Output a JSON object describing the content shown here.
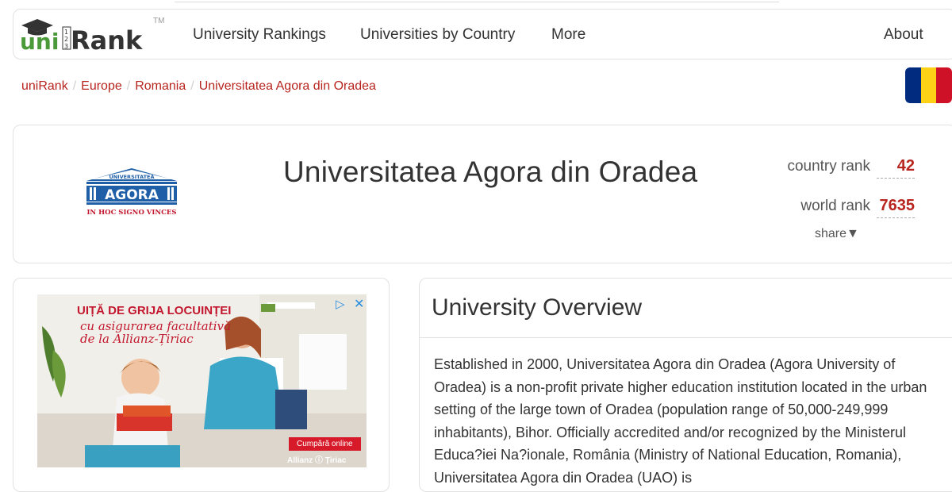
{
  "nav": {
    "logo_text": "uniRank",
    "logo_tm": "TM",
    "links": [
      "University Rankings",
      "Universities by Country",
      "More"
    ],
    "about": "About"
  },
  "breadcrumb": [
    "uniRank",
    "Europe",
    "Romania",
    "Universitatea Agora din Oradea"
  ],
  "flag_colors": [
    "#002b7f",
    "#fcd116",
    "#ce1126"
  ],
  "university": {
    "name": "Universitatea Agora din Oradea",
    "logo_top": "UNIVERSITATEA",
    "logo_main": "AGORA",
    "logo_motto": "IN HOC SIGNO VINCES",
    "country_rank_label": "country rank",
    "country_rank": "42",
    "world_rank_label": "world rank",
    "world_rank": "7635",
    "share_label": "share"
  },
  "ad": {
    "headline": "UIȚĂ DE GRIJA LOCUINȚEI",
    "sub1": "cu asigurarea facultativă",
    "sub2": "de la Allianz-Țiriac",
    "cta": "Cumpără online",
    "brand": "Allianz ⓘ Țiriac"
  },
  "overview": {
    "title": "University Overview",
    "text": "Established in 2000, Universitatea Agora din Oradea (Agora University of Oradea) is a non-profit private higher education institution located in the urban setting of the large town of Oradea (population range of 50,000-249,999 inhabitants), Bihor. Officially accredited and/or recognized by the Ministerul Educa?iei Na?ionale, România (Ministry of National Education, Romania), Universitatea Agora din Oradea (UAO) is"
  },
  "colors": {
    "accent_red": "#b8251f",
    "logo_green": "#4a9a3a",
    "logo_dark": "#333333"
  }
}
